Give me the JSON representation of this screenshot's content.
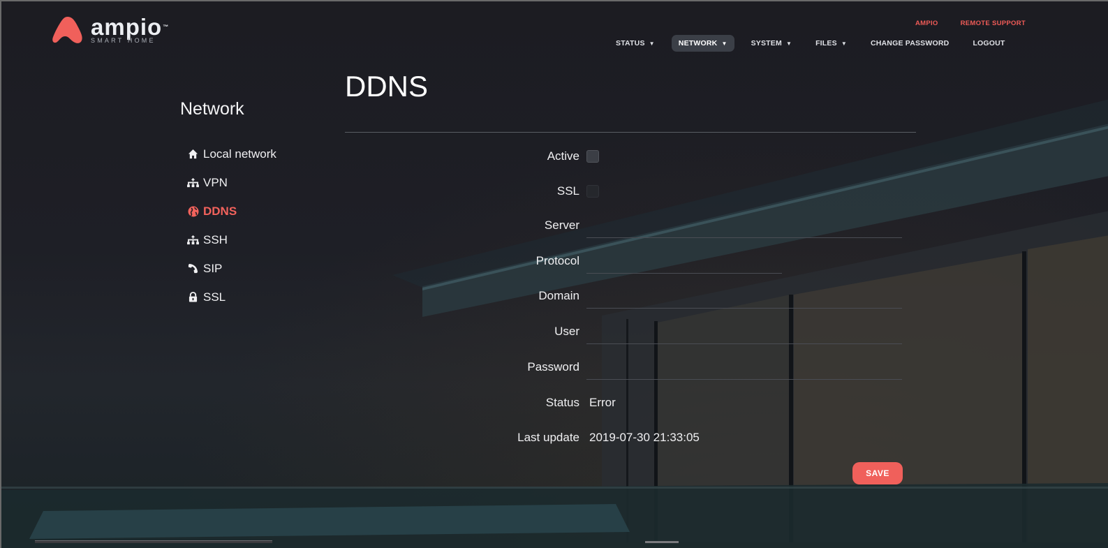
{
  "brand": {
    "name": "ampio",
    "trademark": "™",
    "tagline": "SMART HOME",
    "color": "#f0605b"
  },
  "top_links": [
    "AMPIO",
    "REMOTE SUPPORT"
  ],
  "nav": {
    "items": [
      {
        "label": "STATUS",
        "dropdown": true,
        "active": false
      },
      {
        "label": "NETWORK",
        "dropdown": true,
        "active": true
      },
      {
        "label": "SYSTEM",
        "dropdown": true,
        "active": false
      },
      {
        "label": "FILES",
        "dropdown": true,
        "active": false
      },
      {
        "label": "CHANGE PASSWORD",
        "dropdown": false,
        "active": false
      },
      {
        "label": "LOGOUT",
        "dropdown": false,
        "active": false
      }
    ],
    "caret": "▼"
  },
  "sidebar": {
    "title": "Network",
    "items": [
      {
        "label": "Local network",
        "icon": "home-icon",
        "active": false
      },
      {
        "label": "VPN",
        "icon": "network-icon",
        "active": false
      },
      {
        "label": "DDNS",
        "icon": "globe-icon",
        "active": true
      },
      {
        "label": "SSH",
        "icon": "network-icon",
        "active": false
      },
      {
        "label": "SIP",
        "icon": "phone-icon",
        "active": false
      },
      {
        "label": "SSL",
        "icon": "lock-icon",
        "active": false
      }
    ]
  },
  "main": {
    "title": "DDNS",
    "form": {
      "active_label": "Active",
      "active_checked": false,
      "ssl_label": "SSL",
      "ssl_checked": false,
      "server_label": "Server",
      "server_value": "",
      "protocol_label": "Protocol",
      "protocol_value": "",
      "domain_label": "Domain",
      "domain_value": "",
      "user_label": "User",
      "user_value": "",
      "password_label": "Password",
      "password_value": "",
      "status_label": "Status",
      "status_value": "Error",
      "last_update_label": "Last update",
      "last_update_value": "2019-07-30 21:33:05"
    },
    "save_label": "SAVE"
  }
}
